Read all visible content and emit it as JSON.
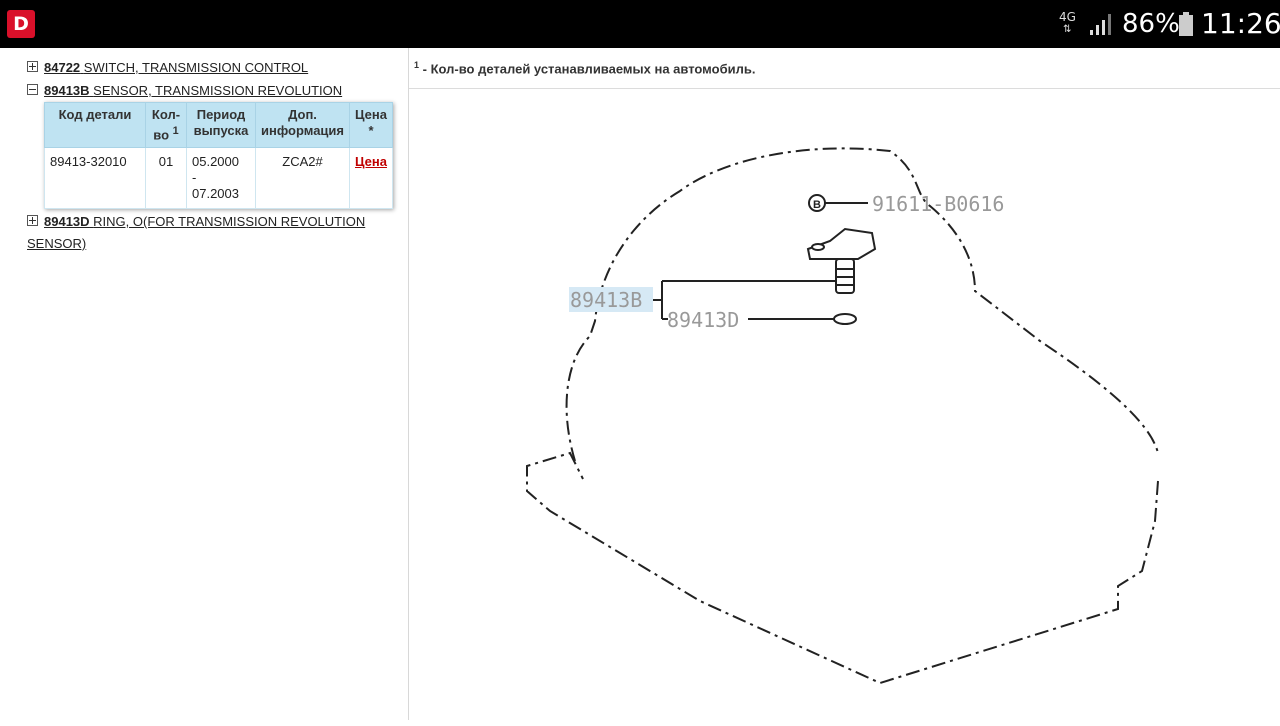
{
  "status_bar": {
    "network": "4G",
    "battery_percent": "86%",
    "time": "11:26",
    "app_icon_letter": "D"
  },
  "tree": [
    {
      "code": "84722",
      "name": "SWITCH, TRANSMISSION CONTROL",
      "expanded": false
    },
    {
      "code": "89413B",
      "name": "SENSOR, TRANSMISSION REVOLUTION",
      "expanded": true
    },
    {
      "code": "89413D",
      "name": "RING, O(FOR TRANSMISSION REVOLUTION",
      "name_line2": "SENSOR)",
      "expanded": false
    }
  ],
  "table": {
    "headers": {
      "code": "Код детали",
      "qty_line1": "Кол-",
      "qty_line2": "во",
      "qty_sup": "1",
      "period_line1": "Период",
      "period_line2": "выпуска",
      "info_line1": "Доп.",
      "info_line2": "информация",
      "price_line1": "Цена",
      "price_line2": "*"
    },
    "row": {
      "code": "89413-32010",
      "qty": "01",
      "period_from": "05.2000",
      "period_dash": "-",
      "period_to": "07.2003",
      "info": "ZCA2#",
      "price": "Цена"
    }
  },
  "footnote": {
    "sup": "1",
    "text": "- Кол-во деталей устанавливаемых на автомобиль."
  },
  "diagram": {
    "labels": {
      "bolt_code": "91611-B0616",
      "bolt_marker": "B",
      "sensor_code": "89413B",
      "ring_code": "89413D"
    },
    "highlight_color": "#d6e9f5"
  }
}
